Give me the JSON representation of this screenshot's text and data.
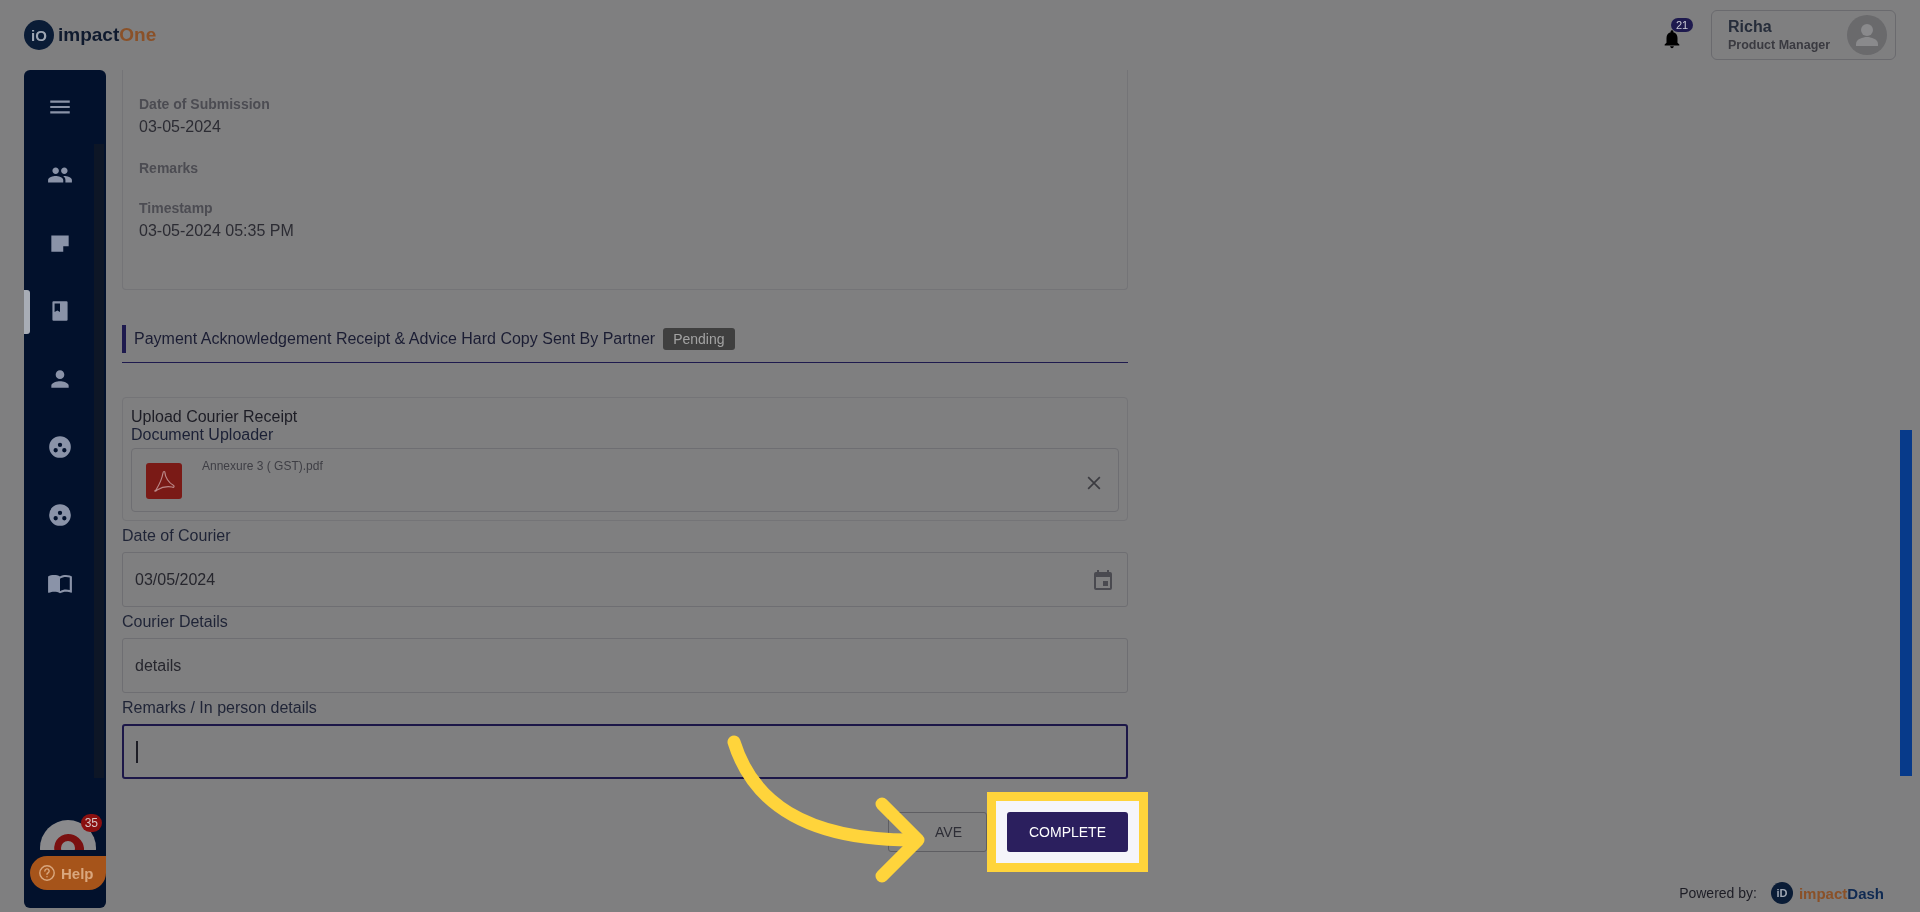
{
  "header": {
    "logo": {
      "mark": "iO",
      "name": "impact",
      "accent": "One"
    },
    "notifications": {
      "count": "21"
    },
    "user": {
      "name": "Richa",
      "role": "Product Manager"
    }
  },
  "sidebar": {
    "items": [
      {
        "kind": "menu",
        "selected": false
      },
      {
        "kind": "people",
        "selected": false
      },
      {
        "kind": "note",
        "selected": false
      },
      {
        "kind": "book",
        "selected": true
      },
      {
        "kind": "person",
        "selected": false
      },
      {
        "kind": "circles",
        "selected": false
      },
      {
        "kind": "circles",
        "selected": false
      },
      {
        "kind": "reader",
        "selected": false
      }
    ],
    "chat": {
      "badge": "35"
    },
    "help": {
      "label": "Help"
    }
  },
  "submission_details": {
    "fields": [
      {
        "label": "Date of Submission",
        "value": "03-05-2024"
      },
      {
        "label": "Remarks"
      },
      {
        "label": "Timestamp",
        "value": "03-05-2024 05:35 PM"
      }
    ]
  },
  "section": {
    "title": "Payment Acknowledgement Receipt & Advice Hard Copy Sent By Partner",
    "status": "Pending"
  },
  "upload": {
    "title": "Upload Courier Receipt",
    "uploader_label": "Document Uploader",
    "file": {
      "name": "Annexure 3 ( GST).pdf"
    }
  },
  "form": {
    "fields": [
      {
        "kind": "date",
        "label": "Date of Courier",
        "value": "03/05/2024",
        "focused": false
      },
      {
        "kind": "text",
        "label": "Courier Details",
        "value": "details",
        "focused": false
      },
      {
        "kind": "text",
        "label": "Remarks / In person details",
        "focused": true
      }
    ]
  },
  "actions": [
    {
      "kind": "outline",
      "label": "AVE",
      "highlighted": false
    },
    {
      "kind": "primary",
      "label": "COMPLETE",
      "highlighted": true
    }
  ],
  "footer": {
    "powered_by": "Powered by:",
    "logo": {
      "mark": "iD",
      "name": "impact",
      "accent": "Dash"
    }
  }
}
